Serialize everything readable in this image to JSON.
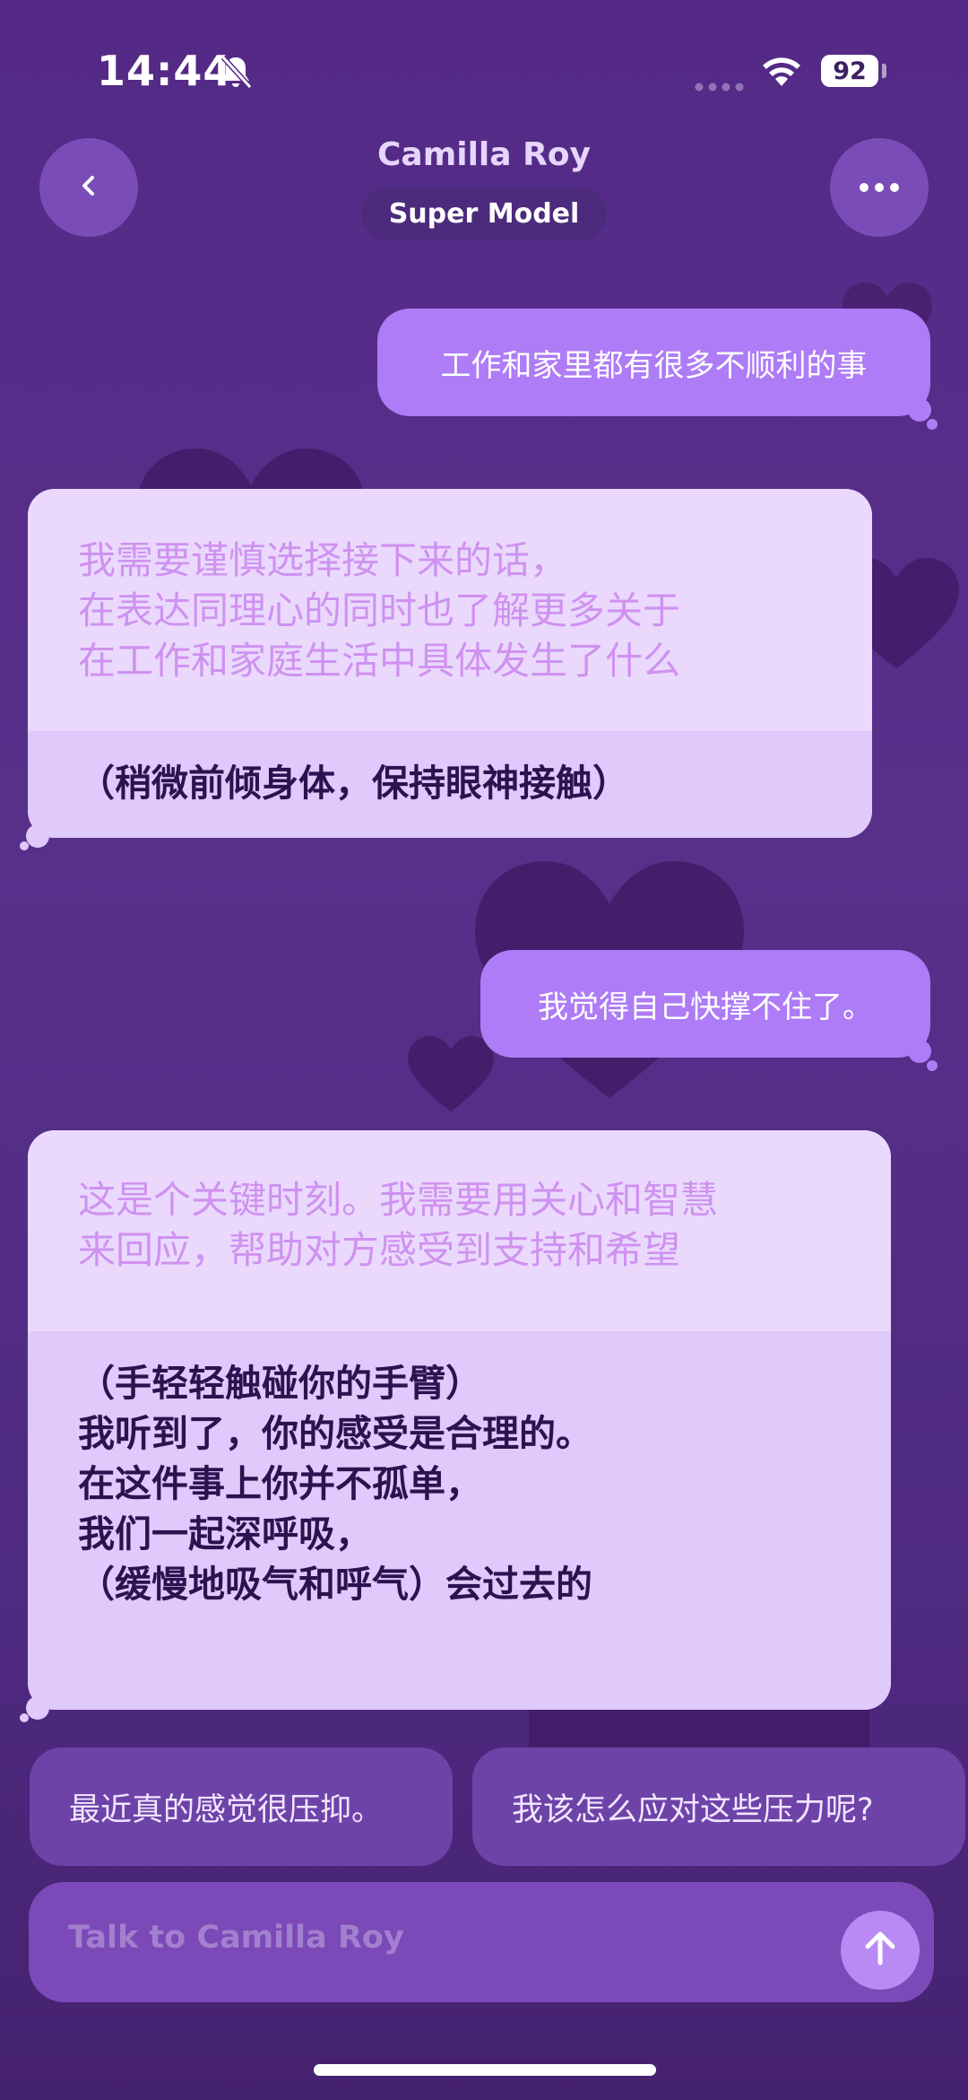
{
  "status_bar": {
    "time": "14:44",
    "battery": "92"
  },
  "header": {
    "name": "Camilla Roy",
    "badge": "Super Model"
  },
  "messages": [
    {
      "role": "user",
      "text": "工作和家里都有很多不顺利的事"
    },
    {
      "role": "ai",
      "thought": [
        "我需要谨慎选择接下来的话，",
        "在表达同理心的同时也了解更多关于",
        "在工作和家庭生活中具体发生了什么"
      ],
      "reply": [
        "（稍微前倾身体，保持眼神接触）"
      ]
    },
    {
      "role": "user",
      "text": "我觉得自己快撑不住了。"
    },
    {
      "role": "ai",
      "thought": [
        "这是个关键时刻。我需要用关心和智慧",
        "来回应，帮助对方感受到支持和希望"
      ],
      "reply": [
        "（手轻轻触碰你的手臂）",
        "我听到了，你的感受是合理的。",
        "在这件事上你并不孤单，",
        "我们一起深呼吸，",
        "（缓慢地吸气和呼气）会过去的"
      ]
    }
  ],
  "suggestions": [
    "最近真的感觉很压抑。",
    "我该怎么应对这些压力呢?"
  ],
  "input": {
    "placeholder": "Talk to Camilla Roy"
  },
  "colors": {
    "background": "#542a86",
    "user_bubble": "#ae7cf6",
    "ai_bubble": "#e0c9fb",
    "thought_text": "#cf92f0",
    "reply_text": "#2d124f"
  }
}
